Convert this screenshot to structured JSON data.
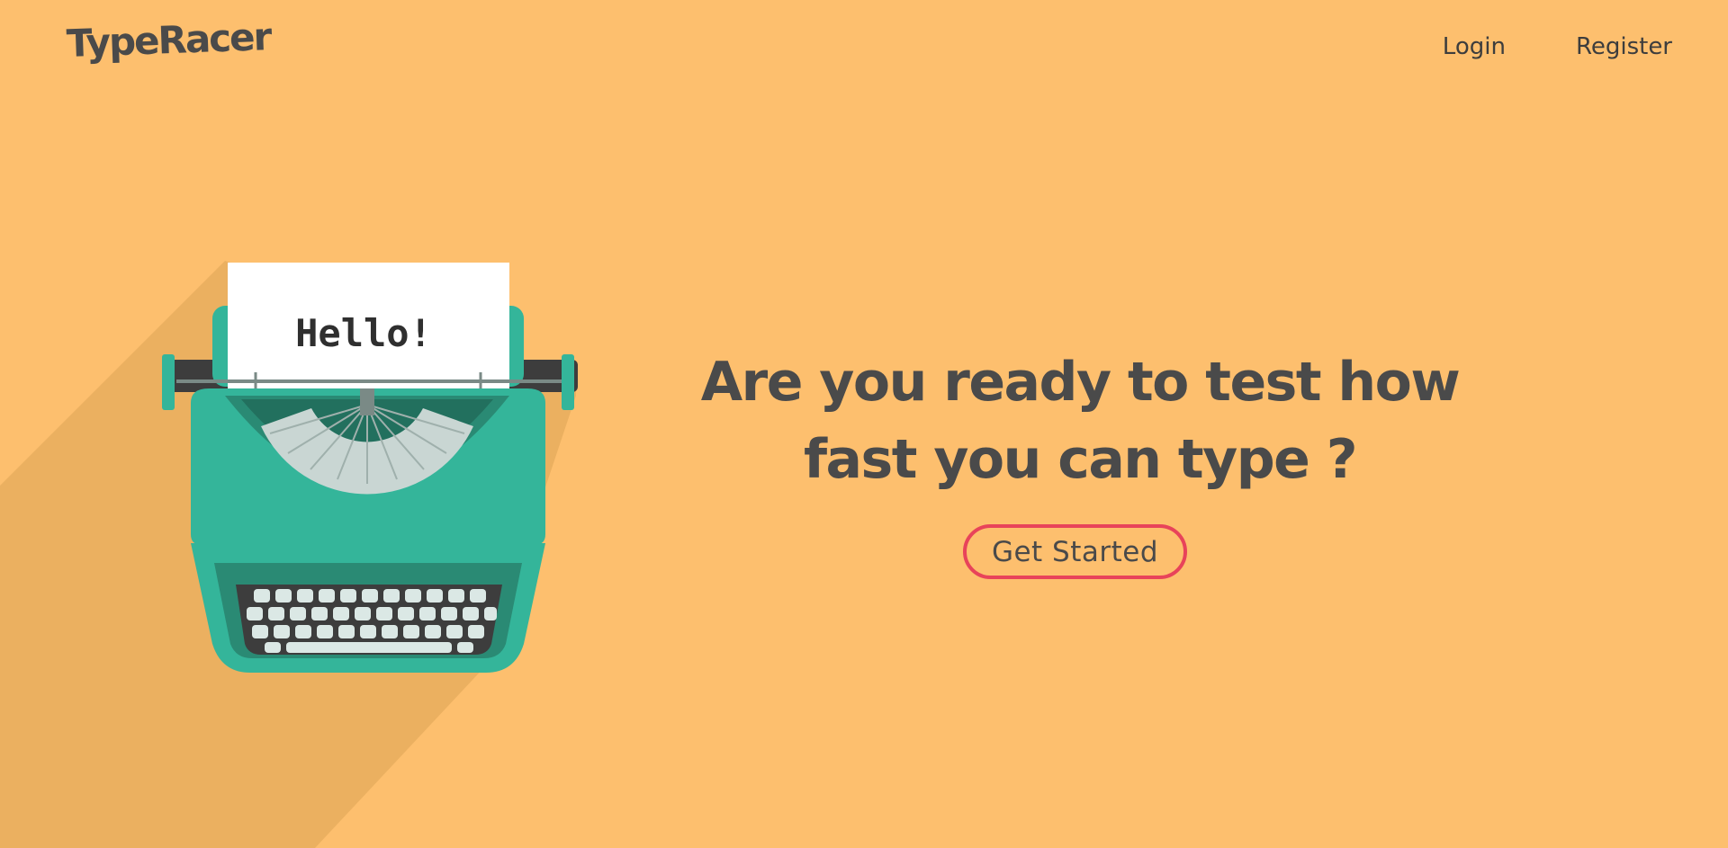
{
  "header": {
    "logo": "TypeRacer",
    "nav": [
      {
        "label": "Login"
      },
      {
        "label": "Register"
      }
    ]
  },
  "hero": {
    "illustration": "typewriter-illustration",
    "paper_text": "Hello!",
    "headline_line1": "Are you ready to test how",
    "headline_line2": "fast you can type ?",
    "cta_label": "Get Started"
  },
  "colors": {
    "background": "#fdbf6e",
    "shadow": "#ebb060",
    "typewriter_teal": "#34b59a",
    "typewriter_dark": "#2a8a74",
    "text": "#4a4a4a",
    "cta_border": "#e8435a"
  }
}
